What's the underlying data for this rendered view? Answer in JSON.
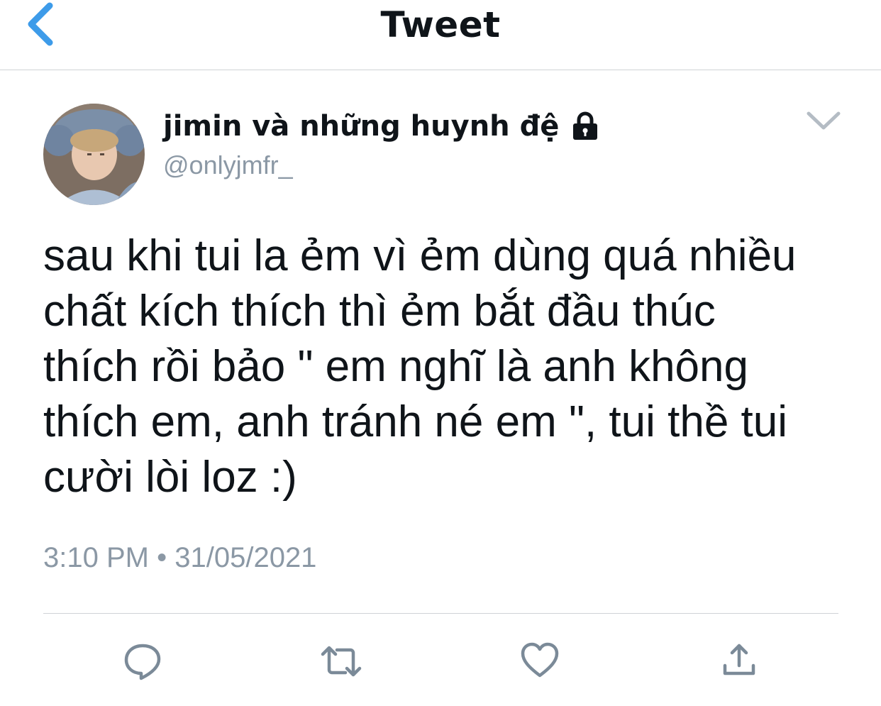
{
  "header": {
    "title": "Tweet",
    "back_icon": "chevron-left-icon",
    "accent_color": "#3d9be9"
  },
  "author": {
    "display_name": "jimin và những huynh đệ",
    "handle": "@onlyjmfr_",
    "protected_icon": "lock-icon",
    "avatar_icon": "avatar-photo"
  },
  "tweet": {
    "text": "sau khi tui la ẻm vì ẻm dùng quá nhiều\nchất kích thích thì ẻm bắt đầu thúc\nthích rồi bảo \" em nghĩ là anh không\nthích em, anh tránh né em \", tui thề tui\ncười lòi loz :)",
    "time": "3:10 PM",
    "separator": "•",
    "date": "31/05/2021"
  },
  "actions": {
    "reply_icon": "reply-icon",
    "retweet_icon": "retweet-icon",
    "like_icon": "heart-icon",
    "share_icon": "share-icon",
    "icon_color": "#7b8a98"
  }
}
